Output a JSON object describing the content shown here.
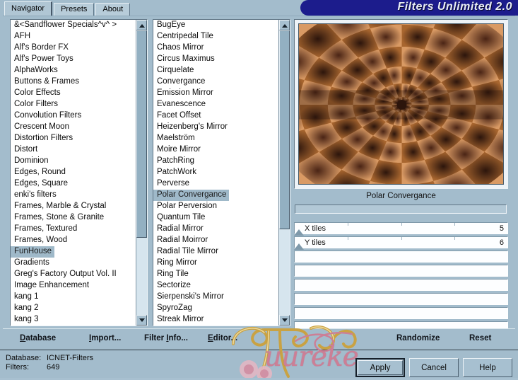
{
  "window": {
    "title": "Filters Unlimited 2.0",
    "title_bg": "#1c1c8c",
    "chrome_bg": "#a3bccc"
  },
  "tabs": [
    {
      "label": "Navigator",
      "active": true
    },
    {
      "label": "Presets",
      "active": false
    },
    {
      "label": "About",
      "active": false
    }
  ],
  "category_list": {
    "name": "filter-category-list",
    "selected": "FunHouse",
    "items": [
      "&<Sandflower Specials^v^ >",
      "AFH",
      "Alf's Border FX",
      "Alf's Power Toys",
      "AlphaWorks",
      "Buttons & Frames",
      "Color Effects",
      "Color Filters",
      "Convolution Filters",
      "Crescent Moon",
      "Distortion Filters",
      "Distort",
      "Dominion",
      "Edges, Round",
      "Edges, Square",
      "enki's filters",
      "Frames, Marble & Crystal",
      "Frames, Stone & Granite",
      "Frames, Textured",
      "Frames, Wood",
      "FunHouse",
      "Gradients",
      "Greg's Factory Output Vol. II",
      "Image Enhancement",
      "kang 1",
      "kang 2",
      "kang 3"
    ],
    "scroll_thumb_top_pct": 0,
    "scroll_thumb_height_pct": 73
  },
  "filter_list": {
    "name": "filter-effect-list",
    "selected": "Polar Convergance",
    "items": [
      "BugEye",
      "Centripedal Tile",
      "Chaos Mirror",
      "Circus Maximus",
      "Cirquelate",
      "Convergance",
      "Emission Mirror",
      "Evanescence",
      "Facet Offset",
      "Heizenberg's Mirror",
      "Maelström",
      "Moire Mirror",
      "PatchRing",
      "PatchWork",
      "Perverse",
      "Polar Convergance",
      "Polar Perversion",
      "Quantum Tile",
      "Radial Mirror",
      "Radial Moirror",
      "Radial Tile Mirror",
      "Ring Mirror",
      "Ring Tile",
      "Sectorize",
      "Sierpenski's Mirror",
      "SpyroZag",
      "Streak Mirror"
    ],
    "scroll_thumb_top_pct": 0,
    "scroll_thumb_height_pct": 70
  },
  "preview": {
    "name": "filter-preview",
    "filter_name": "Polar Convergance",
    "colors": {
      "light": "#d99a64",
      "mid": "#a8662f",
      "dark": "#4a2415",
      "deep": "#2c150c"
    },
    "rings": 6,
    "wedges": 20
  },
  "parameters": {
    "rows": [
      {
        "label": "X tiles",
        "value": "5",
        "knob_pct": 2
      },
      {
        "label": "Y tiles",
        "value": "6",
        "knob_pct": 2
      },
      {
        "label": "",
        "value": "",
        "knob_pct": null
      },
      {
        "label": "",
        "value": "",
        "knob_pct": null
      },
      {
        "label": "",
        "value": "",
        "knob_pct": null
      },
      {
        "label": "",
        "value": "",
        "knob_pct": null
      },
      {
        "label": "",
        "value": "",
        "knob_pct": null
      },
      {
        "label": "",
        "value": "",
        "knob_pct": null
      }
    ]
  },
  "menu": {
    "database": "Database",
    "import": "Import...",
    "filter_info": "Filter Info...",
    "editor": "Editor...",
    "randomize": "Randomize",
    "reset": "Reset"
  },
  "status": {
    "database_key": "Database:",
    "database_value": "ICNET-Filters",
    "filters_key": "Filters:",
    "filters_value": "649"
  },
  "actions": {
    "apply": "Apply",
    "cancel": "Cancel",
    "help": "Help"
  },
  "watermark": {
    "script_text": "uureke",
    "color": "#cc7f96"
  }
}
